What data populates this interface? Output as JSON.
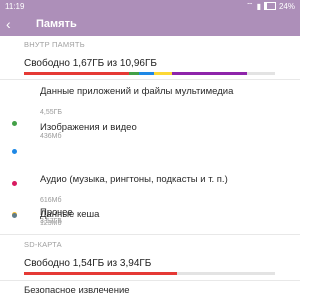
{
  "status_bar": {
    "time": "11:19",
    "battery": "24%"
  },
  "app_bar": {
    "title": "Память"
  },
  "internal": {
    "header": "ВНУТР ПАМЯТЬ",
    "summary": "Свободно 1,67ГБ из 10,96ГБ",
    "usage_bar": [
      {
        "name": "Данные приложений и файлы мультимедиа",
        "fraction": 0.42,
        "color": "#e53935"
      },
      {
        "name": "Изображения и видео",
        "fraction": 0.04,
        "color": "#43a047"
      },
      {
        "name": "Аудио",
        "fraction": 0.06,
        "color": "#1e88e5"
      },
      {
        "name": "Данные кеша",
        "fraction": 0.07,
        "color": "#fdd835"
      },
      {
        "name": "Прочее",
        "fraction": 0.3,
        "color": "#8e24aa"
      }
    ],
    "items": [
      {
        "label": "Данные приложений и файлы мультимедиа",
        "size": "4,55ГБ",
        "color": "#43a047"
      },
      {
        "label": "Изображения и видео",
        "size": "436Мб",
        "color": "#1e88e5"
      },
      {
        "label": "Аудио (музыка, рингтоны, подкасты и т. п.)",
        "size": "616Мб",
        "color": "#d81b60"
      },
      {
        "label": "Данные кеша",
        "size": "123Мб",
        "color": "#fbc02d"
      },
      {
        "label": "Прочее",
        "size": "3,57ГБ",
        "color": "#607d8b"
      }
    ]
  },
  "sd_card": {
    "header": "SD-КАРТА",
    "summary": "Свободно 1,54ГБ из 3,94ГБ",
    "used_fraction": 0.61,
    "used_color": "#e53935",
    "eject_label": "Безопасное извлечение"
  }
}
